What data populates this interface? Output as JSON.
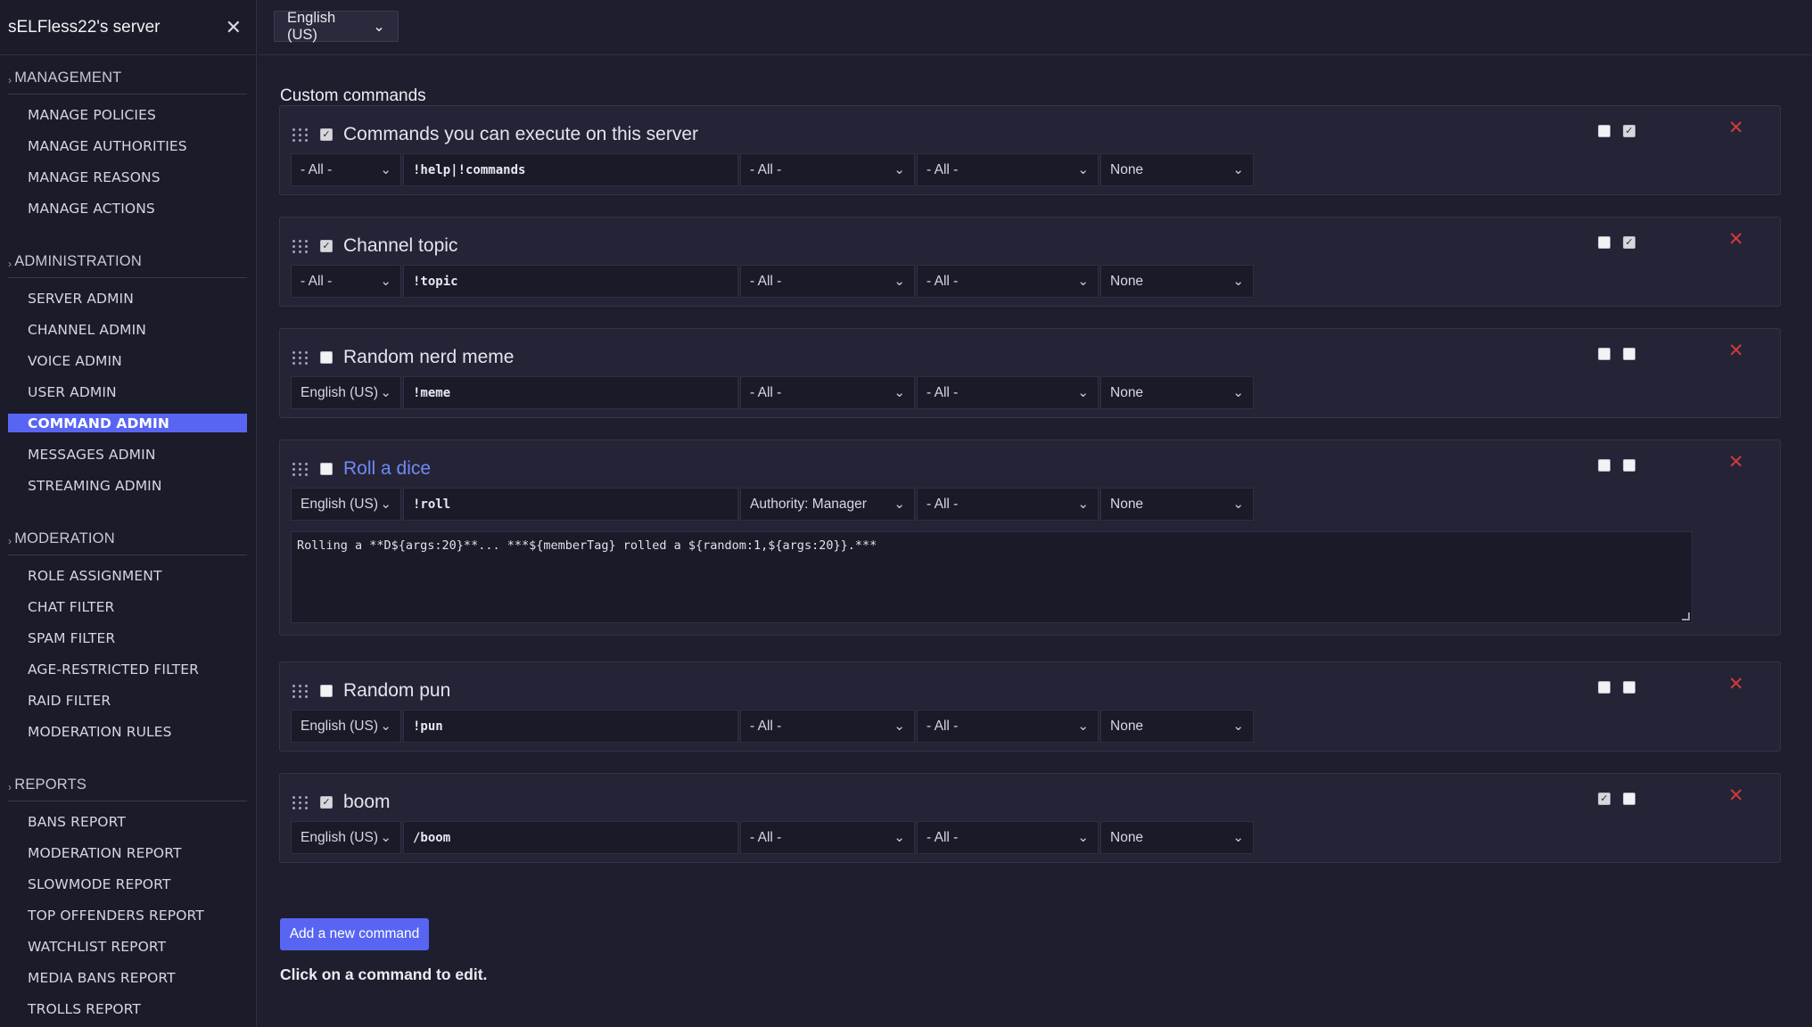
{
  "sidebar": {
    "server_name": "sELFless22's server",
    "close_icon": "✕",
    "sections": [
      {
        "title": "MANAGEMENT",
        "items": [
          "MANAGE POLICIES",
          "MANAGE AUTHORITIES",
          "MANAGE REASONS",
          "MANAGE ACTIONS"
        ]
      },
      {
        "title": "ADMINISTRATION",
        "items": [
          "SERVER ADMIN",
          "CHANNEL ADMIN",
          "VOICE ADMIN",
          "USER ADMIN",
          "COMMAND ADMIN",
          "MESSAGES ADMIN",
          "STREAMING ADMIN"
        ]
      },
      {
        "title": "MODERATION",
        "items": [
          "ROLE ASSIGNMENT",
          "CHAT FILTER",
          "SPAM FILTER",
          "AGE-RESTRICTED FILTER",
          "RAID FILTER",
          "MODERATION RULES"
        ]
      },
      {
        "title": "REPORTS",
        "items": [
          "BANS REPORT",
          "MODERATION REPORT",
          "SLOWMODE REPORT",
          "TOP OFFENDERS REPORT",
          "WATCHLIST REPORT",
          "MEDIA BANS REPORT",
          "TROLLS REPORT"
        ]
      }
    ],
    "active_item": "COMMAND ADMIN"
  },
  "topbar": {
    "language": "English (US)"
  },
  "main": {
    "title": "Custom commands",
    "commands": [
      {
        "name": "Commands you can execute on this server",
        "enabled": true,
        "link": false,
        "language": "- All -",
        "trigger": "!help|!commands",
        "authority": "- All -",
        "channel": "- All -",
        "response_type": "None",
        "flag_a": false,
        "flag_b": true
      },
      {
        "name": "Channel topic",
        "enabled": true,
        "link": false,
        "language": "- All -",
        "trigger": "!topic",
        "authority": "- All -",
        "channel": "- All -",
        "response_type": "None",
        "flag_a": false,
        "flag_b": true
      },
      {
        "name": "Random nerd meme",
        "enabled": false,
        "link": false,
        "language": "English (US)",
        "trigger": "!meme",
        "authority": "- All -",
        "channel": "- All -",
        "response_type": "None",
        "flag_a": false,
        "flag_b": false
      },
      {
        "name": "Roll a dice",
        "enabled": false,
        "link": true,
        "language": "English (US)",
        "trigger": "!roll",
        "authority": "Authority: Manager",
        "channel": "- All -",
        "response_type": "None",
        "flag_a": false,
        "flag_b": false,
        "response": "Rolling a **D${args:20}**... ***${memberTag} rolled a ${random:1,${args:20}}.***"
      },
      {
        "name": "Random pun",
        "enabled": false,
        "link": false,
        "language": "English (US)",
        "trigger": "!pun",
        "authority": "- All -",
        "channel": "- All -",
        "response_type": "None",
        "flag_a": false,
        "flag_b": false
      },
      {
        "name": "boom",
        "enabled": true,
        "link": false,
        "language": "English (US)",
        "trigger": "/boom",
        "authority": "- All -",
        "channel": "- All -",
        "response_type": "None",
        "flag_a": true,
        "flag_b": false
      }
    ],
    "add_button": "Add a new command",
    "hint": "Click on a command to edit."
  },
  "icons": {
    "drag": "drag-handle-icon",
    "delete": "delete-icon",
    "chevron": "chevron-down-icon",
    "check": "✓",
    "delete_glyph": "✕",
    "chevron_glyph": "⌄"
  },
  "colors": {
    "accent": "#5865f2",
    "delete": "#d33a3a",
    "link": "#7289f5"
  }
}
